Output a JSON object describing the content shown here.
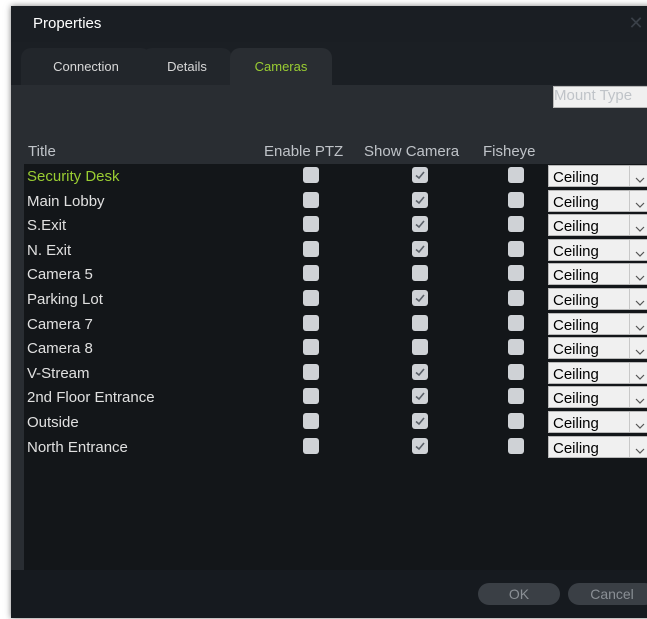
{
  "window": {
    "title": "Properties",
    "close_glyph": "✕"
  },
  "tabs": [
    {
      "label": "Connection",
      "active": false
    },
    {
      "label": "Details",
      "active": false
    },
    {
      "label": "Cameras",
      "active": true
    }
  ],
  "columns": {
    "title": "Title",
    "enable_ptz": "Enable PTZ",
    "show_camera": "Show Camera",
    "fisheye": "Fisheye",
    "mount_type": "Mount Type"
  },
  "rows": [
    {
      "title": "Security Desk",
      "selected": true,
      "ptz": false,
      "show": true,
      "fisheye": false,
      "mount": "Ceiling"
    },
    {
      "title": "Main Lobby",
      "selected": false,
      "ptz": false,
      "show": true,
      "fisheye": false,
      "mount": "Ceiling"
    },
    {
      "title": "S.Exit",
      "selected": false,
      "ptz": false,
      "show": true,
      "fisheye": false,
      "mount": "Ceiling"
    },
    {
      "title": "N. Exit",
      "selected": false,
      "ptz": false,
      "show": true,
      "fisheye": false,
      "mount": "Ceiling"
    },
    {
      "title": "Camera 5",
      "selected": false,
      "ptz": false,
      "show": false,
      "fisheye": false,
      "mount": "Ceiling"
    },
    {
      "title": "Parking Lot",
      "selected": false,
      "ptz": false,
      "show": true,
      "fisheye": false,
      "mount": "Ceiling"
    },
    {
      "title": "Camera 7",
      "selected": false,
      "ptz": false,
      "show": false,
      "fisheye": false,
      "mount": "Ceiling"
    },
    {
      "title": "Camera 8",
      "selected": false,
      "ptz": false,
      "show": false,
      "fisheye": false,
      "mount": "Ceiling"
    },
    {
      "title": "V-Stream",
      "selected": false,
      "ptz": false,
      "show": true,
      "fisheye": false,
      "mount": "Ceiling"
    },
    {
      "title": "2nd Floor Entrance",
      "selected": false,
      "ptz": false,
      "show": true,
      "fisheye": false,
      "mount": "Ceiling"
    },
    {
      "title": "Outside",
      "selected": false,
      "ptz": false,
      "show": true,
      "fisheye": false,
      "mount": "Ceiling"
    },
    {
      "title": "North Entrance",
      "selected": false,
      "ptz": false,
      "show": true,
      "fisheye": false,
      "mount": "Ceiling"
    }
  ],
  "buttons": {
    "ok": "OK",
    "cancel": "Cancel"
  },
  "colors": {
    "accent_green": "#9acd32",
    "background_dark": "#131619",
    "panel": "#292d32",
    "checkbox": "#cfd2d6"
  }
}
